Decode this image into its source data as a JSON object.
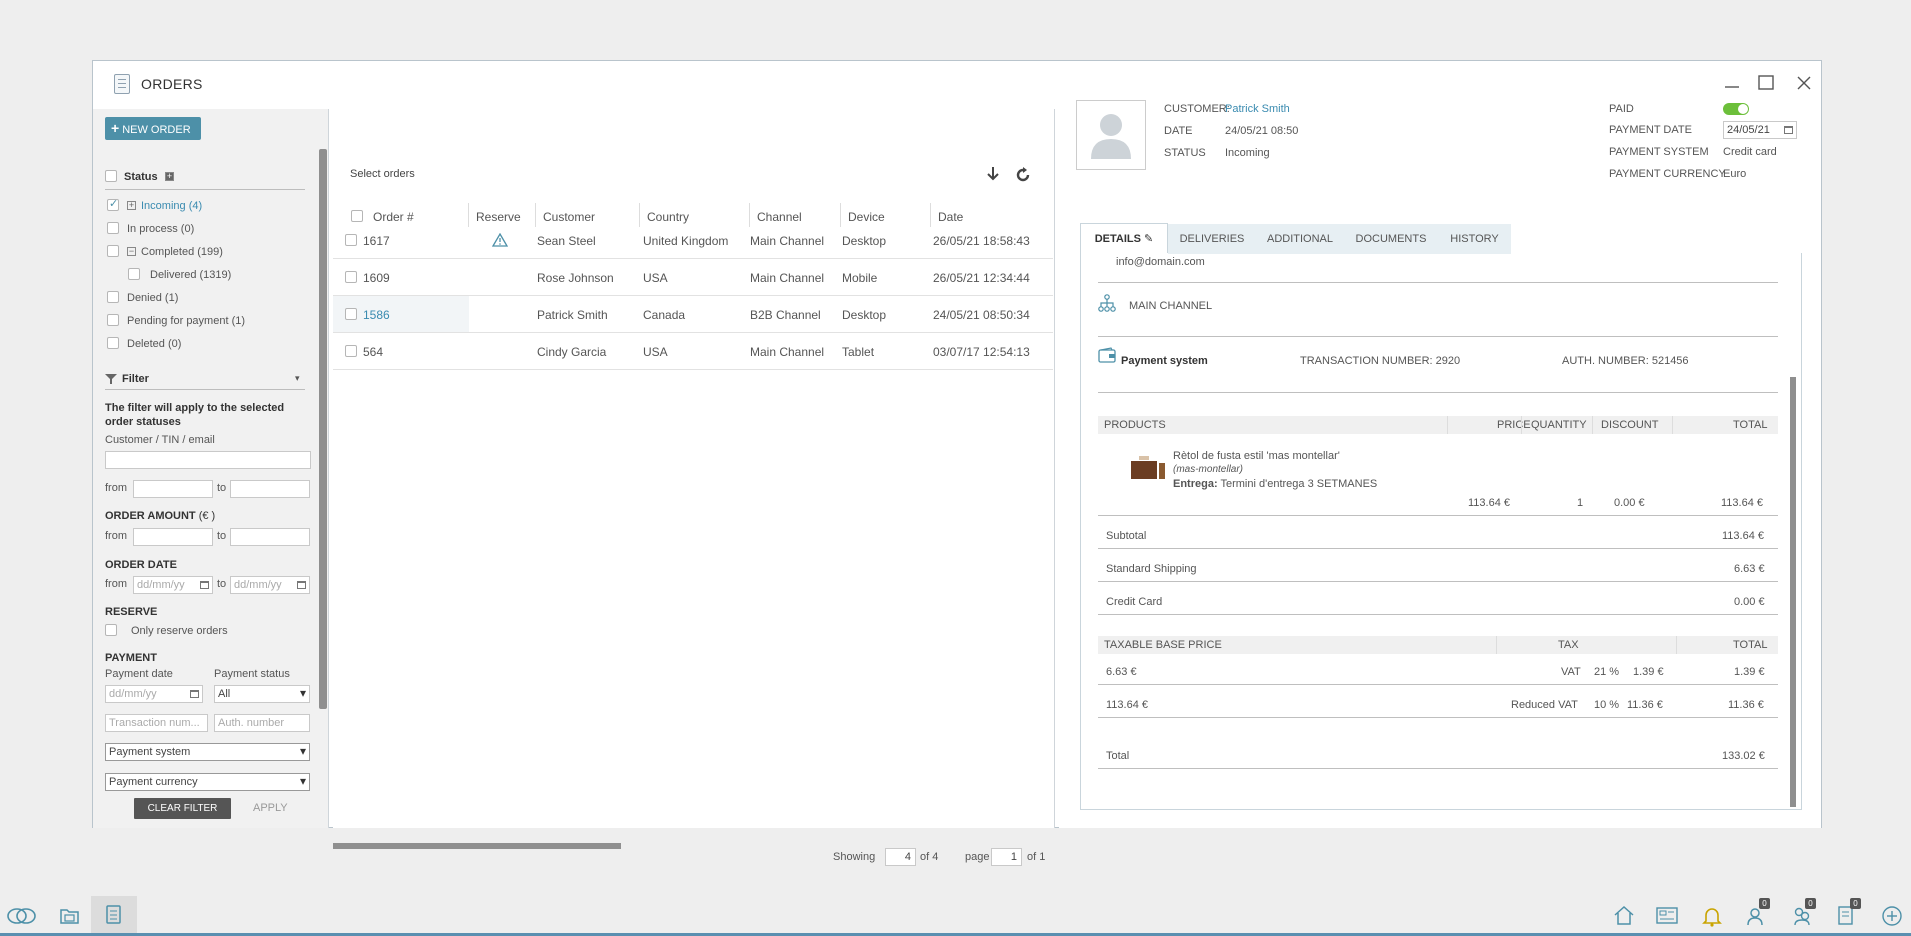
{
  "window": {
    "title": "ORDERS"
  },
  "left": {
    "new_order": "NEW ORDER",
    "status_title": "Status",
    "statuses": [
      "Incoming (4)",
      "In process (0)",
      "Completed (199)",
      "Delivered (1319)",
      "Denied (1)",
      "Pending for payment (1)",
      "Deleted (0)"
    ],
    "filter_title": "Filter",
    "filter_note": "The filter will apply to the selected order statuses",
    "customer_label": "Customer / TIN / email",
    "from": "from",
    "to": "to",
    "order_amount": "ORDER AMOUNT",
    "order_amount_unit": "(€ )",
    "order_date": "ORDER DATE",
    "date_placeholder": "dd/mm/yy",
    "reserve": "RESERVE",
    "only_reserve": "Only reserve orders",
    "payment": "PAYMENT",
    "payment_date": "Payment date",
    "payment_status": "Payment status",
    "payment_status_value": "All",
    "transaction_placeholder": "Transaction num...",
    "auth_placeholder": "Auth. number",
    "payment_system": "Payment system",
    "payment_currency": "Payment currency",
    "clear_filter": "CLEAR FILTER",
    "apply": "APPLY"
  },
  "list": {
    "select_orders": "Select orders",
    "headers": [
      "Order #",
      "Reserve",
      "Customer",
      "Country",
      "Channel",
      "Device",
      "Date"
    ],
    "rows": [
      {
        "order": "1617",
        "customer": "Sean Steel",
        "country": "United Kingdom",
        "channel": "Main Channel",
        "device": "Desktop",
        "date": "26/05/21 18:58:43"
      },
      {
        "order": "1609",
        "customer": "Rose Johnson",
        "country": "USA",
        "channel": "Main Channel",
        "device": "Mobile",
        "date": "26/05/21 12:34:44"
      },
      {
        "order": "1586",
        "customer": "Patrick Smith",
        "country": "Canada",
        "channel": "B2B Channel",
        "device": "Desktop",
        "date": "24/05/21 08:50:34"
      },
      {
        "order": "564",
        "customer": "Cindy Garcia",
        "country": "USA",
        "channel": "Main Channel",
        "device": "Tablet",
        "date": "03/07/17 12:54:13"
      }
    ],
    "showing": "Showing",
    "showing_value": "4",
    "of_total": "of 4",
    "page": "page",
    "page_value": "1",
    "of_pages": "of 1"
  },
  "detail": {
    "customer_label": "CUSTOMER:",
    "customer_value": "Patrick Smith",
    "date_label": "DATE",
    "date_value": "24/05/21 08:50",
    "status_label": "STATUS",
    "status_value": "Incoming",
    "paid_label": "PAID",
    "payment_date_label": "PAYMENT DATE",
    "payment_date_value": "24/05/21",
    "payment_system_label": "PAYMENT SYSTEM",
    "payment_system_value": "Credit card",
    "payment_currency_label": "PAYMENT CURRENCY",
    "payment_currency_value": "Euro",
    "tabs": [
      "DETAILS",
      "DELIVERIES",
      "ADDITIONAL",
      "DOCUMENTS",
      "HISTORY"
    ],
    "email": "info@domain.com",
    "channel": "MAIN CHANNEL",
    "payment_system_title": "Payment system",
    "transaction": "TRANSACTION NUMBER: 2920",
    "auth": "AUTH. NUMBER: 521456",
    "products_headers": [
      "PRODUCTS",
      "PRICE",
      "QUANTITY",
      "DISCOUNT",
      "TOTAL"
    ],
    "product": {
      "name": "Rètol de fusta estil 'mas montellar'",
      "sku": "(mas-montellar)",
      "delivery_label": "Entrega:",
      "delivery_value": "Termini d'entrega 3 SETMANES",
      "price": "113.64 €",
      "quantity": "1",
      "discount": "0.00 €",
      "total": "113.64 €"
    },
    "summary": [
      {
        "label": "Subtotal",
        "value": "113.64 €"
      },
      {
        "label": "Standard Shipping",
        "value": "6.63 €"
      },
      {
        "label": "Credit Card",
        "value": "0.00 €"
      }
    ],
    "tax_headers": [
      "TAXABLE BASE PRICE",
      "TAX",
      "TOTAL"
    ],
    "tax_rows": [
      {
        "base": "6.63 €",
        "name": "VAT",
        "rate": "21 %",
        "amount": "1.39 €",
        "total": "1.39 €"
      },
      {
        "base": "113.64 €",
        "name": "Reduced VAT",
        "rate": "10 %",
        "amount": "11.36 €",
        "total": "11.36 €"
      }
    ],
    "total_label": "Total",
    "total_value": "133.02 €"
  },
  "taskbar": {
    "badges": [
      "0",
      "0",
      "0"
    ]
  },
  "colors": {
    "accent": "#4d90a8",
    "link": "#3a8bb0",
    "toggle": "#6cbf3a"
  }
}
